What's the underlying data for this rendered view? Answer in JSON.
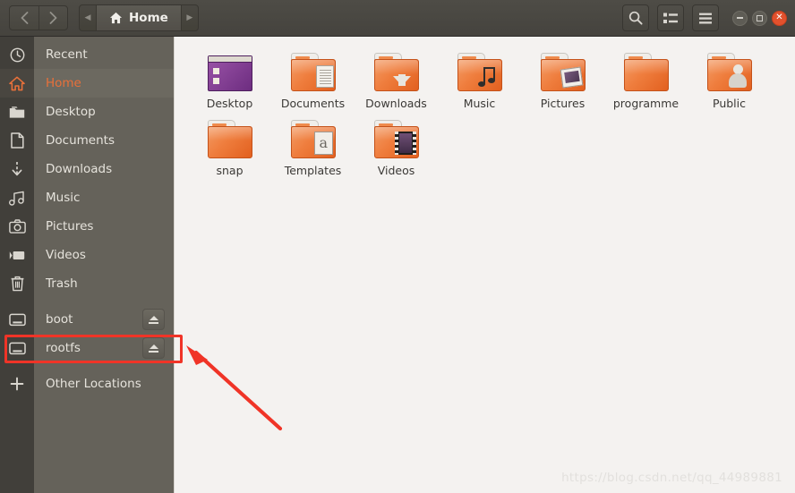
{
  "window": {
    "title": "Home",
    "nav": {
      "back": "‹",
      "forward": "›"
    },
    "breadcrumb": {
      "prev_arrow": "◀",
      "next_arrow": "▶",
      "current": "Home",
      "home_icon": "home-icon"
    },
    "toolbar": [
      {
        "name": "search-button",
        "icon": "search-icon",
        "label": "Search"
      },
      {
        "name": "view-toggle-button",
        "icon": "list-view-icon",
        "label": "View options"
      },
      {
        "name": "menu-button",
        "icon": "hamburger-menu-icon",
        "label": "Menu"
      }
    ],
    "controls": {
      "minimize": "minimize-icon",
      "maximize": "maximize-icon",
      "close": "close-icon",
      "close_color": "#e2512d"
    }
  },
  "sidebar": {
    "items": [
      {
        "label": "Recent",
        "icon": "clock-icon",
        "selected": false,
        "eject": false
      },
      {
        "label": "Home",
        "icon": "home-icon",
        "selected": true,
        "eject": false
      },
      {
        "label": "Desktop",
        "icon": "folder-icon",
        "selected": false,
        "eject": false
      },
      {
        "label": "Documents",
        "icon": "document-icon",
        "selected": false,
        "eject": false
      },
      {
        "label": "Downloads",
        "icon": "download-icon",
        "selected": false,
        "eject": false
      },
      {
        "label": "Music",
        "icon": "music-note-icon",
        "selected": false,
        "eject": false
      },
      {
        "label": "Pictures",
        "icon": "camera-icon",
        "selected": false,
        "eject": false
      },
      {
        "label": "Videos",
        "icon": "video-camera-icon",
        "selected": false,
        "eject": false
      },
      {
        "label": "Trash",
        "icon": "trash-icon",
        "selected": false,
        "eject": false
      },
      {
        "label": "boot",
        "icon": "hard-drive-icon",
        "selected": false,
        "eject": true
      },
      {
        "label": "rootfs",
        "icon": "hard-drive-icon",
        "selected": false,
        "eject": true
      },
      {
        "label": "Other Locations",
        "icon": "plus-icon",
        "selected": false,
        "eject": false
      }
    ],
    "selected_accent": "#e8703a"
  },
  "files": [
    {
      "label": "Desktop",
      "kind": "desktop-window"
    },
    {
      "label": "Documents",
      "kind": "folder-documents"
    },
    {
      "label": "Downloads",
      "kind": "folder-downloads"
    },
    {
      "label": "Music",
      "kind": "folder-music"
    },
    {
      "label": "Pictures",
      "kind": "folder-pictures"
    },
    {
      "label": "programme",
      "kind": "folder-plain"
    },
    {
      "label": "Public",
      "kind": "folder-public"
    },
    {
      "label": "snap",
      "kind": "folder-plain"
    },
    {
      "label": "Templates",
      "kind": "folder-templates"
    },
    {
      "label": "Videos",
      "kind": "folder-videos"
    }
  ],
  "annotations": {
    "highlight_target": "rootfs",
    "highlight_color": "#f03427",
    "arrow_color": "#f03427"
  },
  "watermark": "https://blog.csdn.net/qq_44989881"
}
